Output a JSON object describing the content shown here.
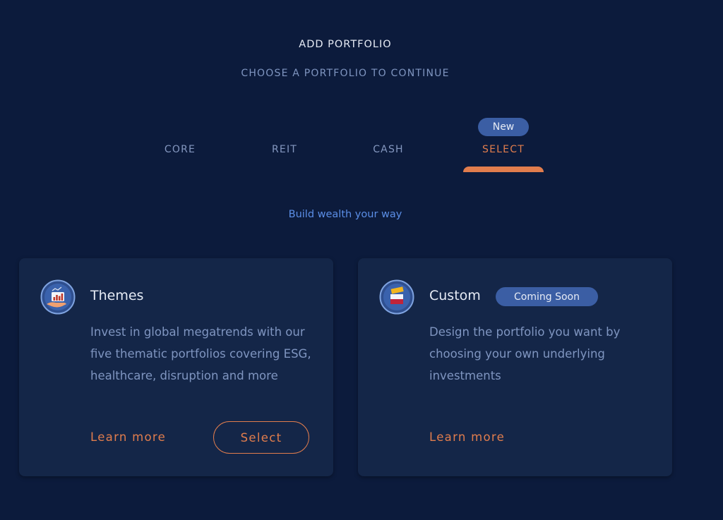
{
  "header": {
    "title": "ADD PORTFOLIO",
    "subtitle": "CHOOSE A PORTFOLIO TO CONTINUE"
  },
  "tabs": [
    {
      "label": "CORE",
      "active": false
    },
    {
      "label": "REIT",
      "active": false
    },
    {
      "label": "CASH",
      "active": false
    },
    {
      "label": "SELECT",
      "active": true,
      "badge": "New"
    }
  ],
  "tagline": "Build wealth your way",
  "cards": [
    {
      "icon": "themes-chart-hand-icon",
      "title": "Themes",
      "description": "Invest in global megatrends with our five thematic portfolios covering ESG, healthcare, disruption and more",
      "learn_more": "Learn more",
      "select": "Select"
    },
    {
      "icon": "custom-blocks-icon",
      "title": "Custom",
      "badge": "Coming Soon",
      "description": "Design the portfolio you want by choosing your own underlying investments",
      "learn_more": "Learn more"
    }
  ],
  "colors": {
    "background": "#0c1b3c",
    "card": "#142648",
    "accent": "#e17d4d",
    "badge": "#3b5ea4",
    "link": "#5b8ee6",
    "muted_text": "#7f95c0"
  }
}
